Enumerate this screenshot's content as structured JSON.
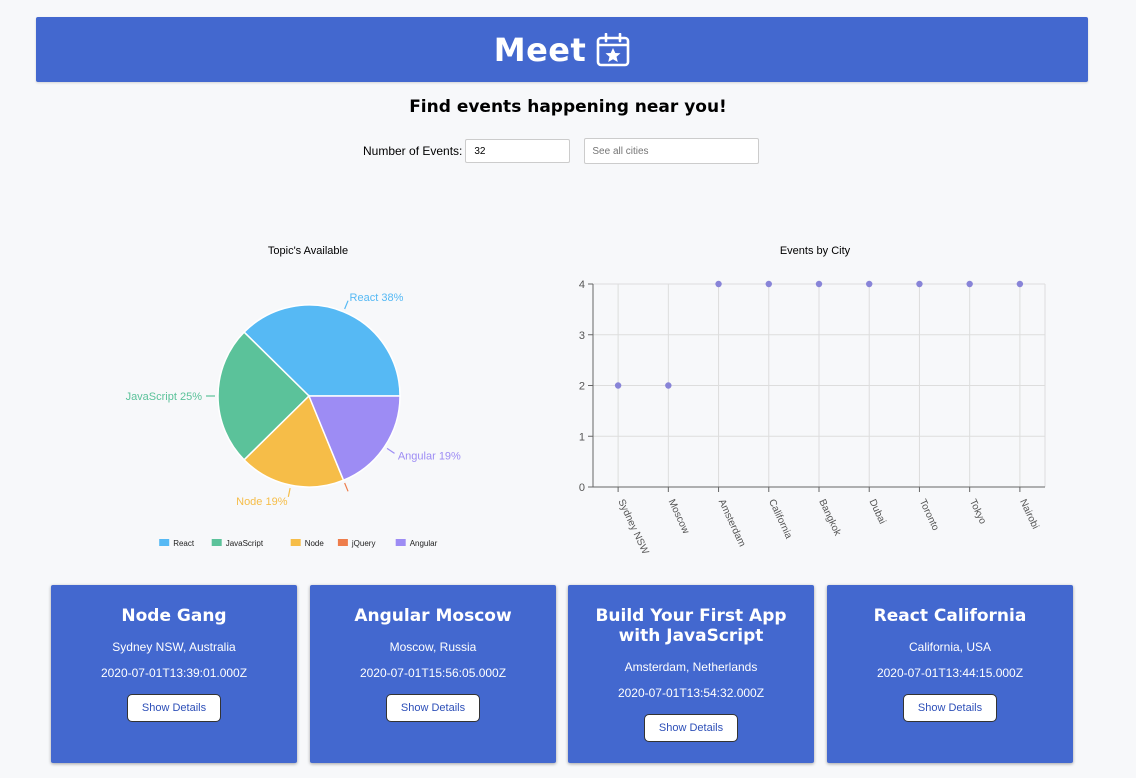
{
  "header": {
    "title": "Meet",
    "icon": "calendar-star-icon"
  },
  "tagline": "Find events happening near you!",
  "controls": {
    "number_label": "Number of Events:",
    "number_value": "32",
    "city_placeholder": "See all cities"
  },
  "pie": {
    "title": "Topic's Available",
    "legend": [
      "React",
      "JavaScript",
      "Node",
      "jQuery",
      "Angular"
    ]
  },
  "scatter": {
    "title": "Events by City"
  },
  "chart_data": [
    {
      "type": "pie",
      "title": "Topic's Available",
      "categories": [
        "React",
        "JavaScript",
        "Node",
        "jQuery",
        "Angular"
      ],
      "values": [
        38,
        25,
        19,
        0,
        19
      ],
      "slice_labels": [
        "React 38%",
        "JavaScript 25%",
        "Node 19%",
        "",
        "Angular 19%"
      ],
      "colors": [
        "#56b9f4",
        "#5bc29a",
        "#f6bd48",
        "#ee7d4b",
        "#9d8cf4"
      ],
      "legend_position": "bottom"
    },
    {
      "type": "scatter",
      "title": "Events by City",
      "categories": [
        "Sydney NSW",
        "Moscow",
        "Amsterdam",
        "California",
        "Bangkok",
        "Dubai",
        "Toronto",
        "Tokyo",
        "Nairobi"
      ],
      "values": [
        2,
        2,
        4,
        4,
        4,
        4,
        4,
        4,
        4
      ],
      "y_ticks": [
        "0",
        "1",
        "2",
        "3",
        "4"
      ],
      "ylim": [
        0,
        4
      ],
      "grid": true,
      "point_color": "#8884d8"
    }
  ],
  "events": [
    {
      "title": "Node Gang",
      "location": "Sydney NSW, Australia",
      "date": "2020-07-01T13:39:01.000Z",
      "button": "Show Details"
    },
    {
      "title": "Angular Moscow",
      "location": "Moscow, Russia",
      "date": "2020-07-01T15:56:05.000Z",
      "button": "Show Details"
    },
    {
      "title": "Build Your First App with JavaScript",
      "location": "Amsterdam, Netherlands",
      "date": "2020-07-01T13:54:32.000Z",
      "button": "Show Details"
    },
    {
      "title": "React California",
      "location": "California, USA",
      "date": "2020-07-01T13:44:15.000Z",
      "button": "Show Details"
    }
  ],
  "colors": {
    "brand": "#4368cf",
    "background": "#f7f8fa"
  }
}
